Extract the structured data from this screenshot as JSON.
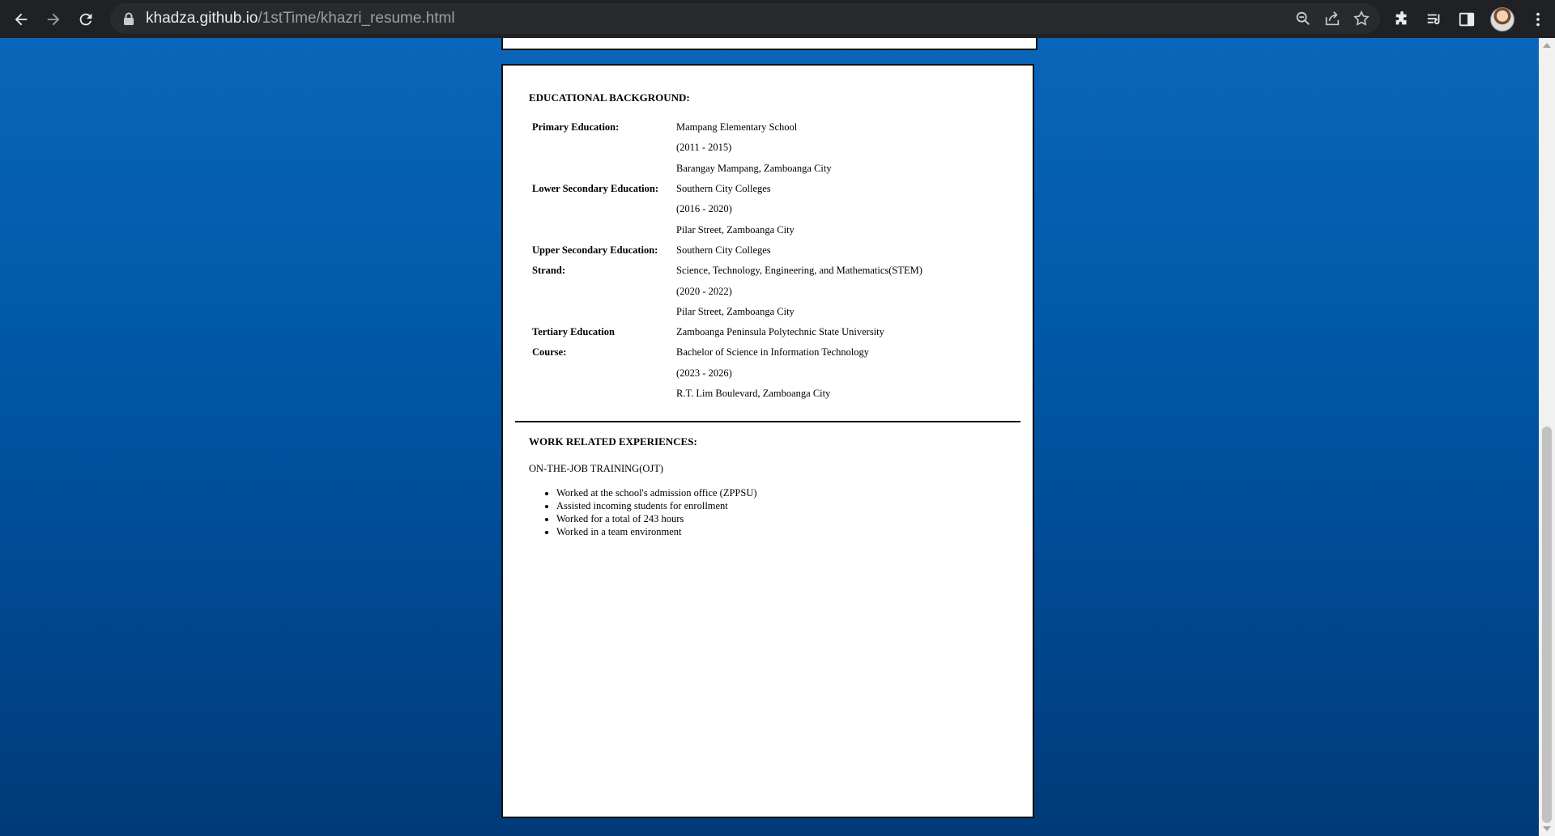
{
  "browser": {
    "url_host": "khadza.github.io",
    "url_path": "/1stTime/khazri_resume.html"
  },
  "education": {
    "title": "EDUCATIONAL BACKGROUND:",
    "rows": [
      {
        "label": "Primary Education:",
        "value": "Mampang Elementary School"
      },
      {
        "label": "",
        "value": "(2011 - 2015)"
      },
      {
        "label": "",
        "value": "Barangay Mampang, Zamboanga City"
      },
      {
        "label": "Lower Secondary Education:",
        "value": "Southern City Colleges"
      },
      {
        "label": "",
        "value": "(2016 - 2020)"
      },
      {
        "label": "",
        "value": "Pilar Street, Zamboanga City"
      },
      {
        "label": "Upper Secondary Education:",
        "value": "Southern City Colleges"
      },
      {
        "label": "Strand:",
        "value": "Science, Technology, Engineering, and Mathematics(STEM)"
      },
      {
        "label": "",
        "value": "(2020 - 2022)"
      },
      {
        "label": "",
        "value": "Pilar Street, Zamboanga City"
      },
      {
        "label": "Tertiary Education",
        "value": "Zamboanga Peninsula Polytechnic State University"
      },
      {
        "label": "Course:",
        "value": "Bachelor of Science in Information Technology"
      },
      {
        "label": "",
        "value": "(2023 - 2026)"
      },
      {
        "label": "",
        "value": "R.T. Lim Boulevard, Zamboanga City"
      }
    ]
  },
  "work": {
    "title": "WORK RELATED EXPERIENCES:",
    "subtitle": "ON-THE-JOB TRAINING(OJT)",
    "tasks": [
      "Worked at the school's admission office (ZPPSU)",
      "Assisted incoming students for enrollment",
      "Worked for a total of 243 hours",
      "Worked in a team environment"
    ]
  }
}
